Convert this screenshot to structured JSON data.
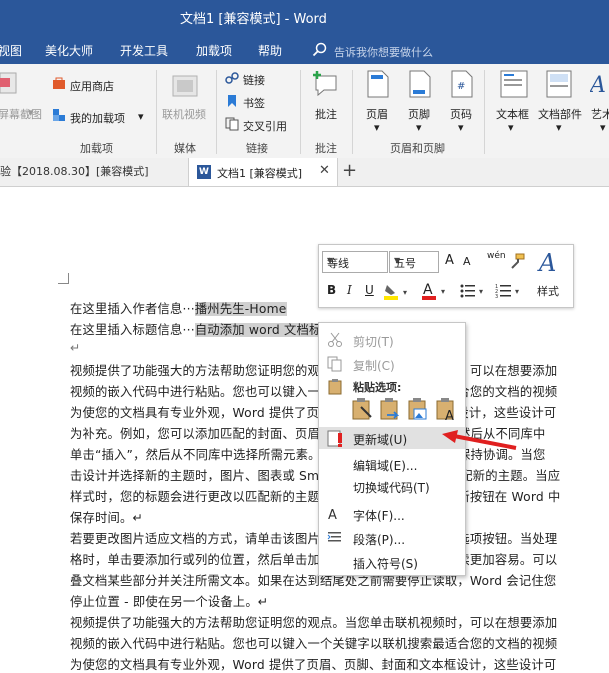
{
  "window": {
    "title": "文档1 [兼容模式] - Word"
  },
  "menu": {
    "items": [
      "视图",
      "美化大师",
      "开发工具",
      "加载项",
      "帮助"
    ],
    "tellme_placeholder": "告诉我你想要做什么"
  },
  "ribbon": {
    "groups": {
      "addins_label": "加载项",
      "media_label": "媒体",
      "links_label": "链接",
      "comments_label": "批注",
      "header_footer_label": "页眉和页脚"
    },
    "screenshot_label": "屏幕截图",
    "store_label": "应用商店",
    "my_addins_label": "我的加载项",
    "online_video_label": "联机视频",
    "link_label": "链接",
    "bookmark_label": "书签",
    "crossref_label": "交叉引用",
    "comment_label": "批注",
    "header_label": "页眉",
    "footer_label": "页脚",
    "pagenum_label": "页码",
    "textbox_label": "文本框",
    "docparts_label": "文档部件",
    "wordart_label": "艺术"
  },
  "doctabs": {
    "tab1": "验【2018.08.30】[兼容模式]",
    "tab2": "文档1 [兼容模式]",
    "word_letter": "W",
    "close": "✕",
    "add": "+"
  },
  "document": {
    "line1_prefix": "在这里插入作者信息···",
    "line1_field": "播州先生-Home",
    "line2_prefix": "在这里插入标题信息···",
    "line2_field": "自动添加 word 文",
    "line2_hidden": "档标题信息",
    "para_mark": "↵",
    "lines": [
      "视频提供了功能强大的方法帮助您证明您的观点。当您单击联机视频时，可以在想要添加",
      "视频的嵌入代码中进行粘贴。您也可以键入一个关键字以联机搜索最适合您的文档的视频",
      "为使您的文档具有专业外观，Word 提供了页眉、页脚、封面和文本框设计，这些设计可",
      "为补充。例如，您可以添加匹配的封面、页眉和提要栏。单击“插入”，然后从不同库中",
      "单击“插入”，然后从不同库中选择所需元素。主题和样式也有助于文档保持协调。当您",
      "击设计并选择新的主题时，图片、图表或 SmartArt 图形将会更改以匹配新的主题。当应",
      "样式时，您的标题会进行更改以匹配新的主题。使用在需要位置出现的新按钮在 Word 中",
      "保存时间。↵",
      "若要更改图片适应文档的方式，请单击该图片，图片旁边将会显示布局选项按钮。当处理",
      "格时，单击要添加行或列的位置，然后单击加号。在新的阅读视图中阅读更加容易。可以",
      "叠文档某些部分并关注所需文本。如果在达到结尾处之前需要停止读取，Word 会记住您",
      "停止位置 - 即使在另一个设备上。↵",
      "视频提供了功能强大的方法帮助您证明您的观点。当您单击联机视频时，可以在想要添加",
      "视频的嵌入代码中进行粘贴。您也可以键入一个关键字以联机搜索最适合您的文档的视频",
      "为使您的文档具有专业外观，Word 提供了页眉、页脚、封面和文本框设计，这些设计可"
    ]
  },
  "mini_toolbar": {
    "font": "等线",
    "size": "五号",
    "grow": "A",
    "shrink": "A",
    "phonetic": "wén",
    "bold": "B",
    "italic": "I",
    "underline": "U",
    "styles_label": "样式"
  },
  "context_menu": {
    "cut": "剪切(T)",
    "copy": "复制(C)",
    "paste_header": "粘贴选项:",
    "update_field": "更新域(U)",
    "edit_field": "编辑域(E)...",
    "toggle_codes": "切换域代码(T)",
    "font": "字体(F)...",
    "paragraph": "段落(P)...",
    "insert_symbol": "插入符号(S)"
  },
  "colors": {
    "ribbon_blue": "#2b579a",
    "highlight": "#d0d0d0",
    "arrow_red": "#e02020"
  }
}
